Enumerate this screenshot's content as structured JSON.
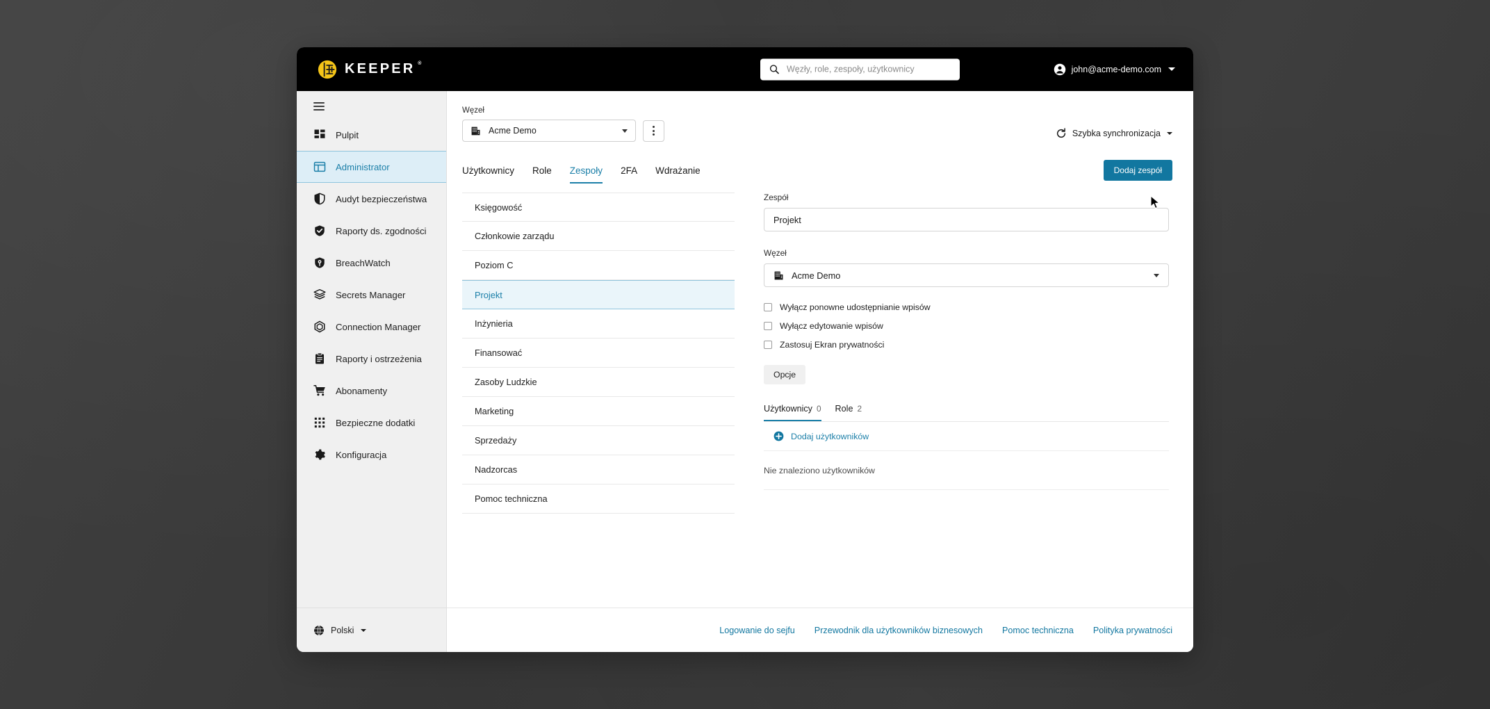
{
  "app": {
    "brand_name": "KEEPER",
    "brand_icon": "keeper-logo-icon"
  },
  "search": {
    "placeholder": "Węzły, role, zespoły, użytkownicy",
    "value": "",
    "icon": "search-icon"
  },
  "account": {
    "email": "john@acme-demo.com",
    "icon": "account-circle-icon",
    "caret": "chevron-down-icon"
  },
  "sidebar": {
    "menu_icon": "hamburger-menu-icon",
    "items": [
      {
        "label": "Pulpit",
        "icon": "dashboard-icon",
        "active": false
      },
      {
        "label": "Administrator",
        "icon": "admin-panel-icon",
        "active": true
      },
      {
        "label": "Audyt bezpieczeństwa",
        "icon": "shield-outline-icon",
        "active": false
      },
      {
        "label": "Raporty ds. zgodności",
        "icon": "shield-check-icon",
        "active": false
      },
      {
        "label": "BreachWatch",
        "icon": "breachwatch-shield-icon",
        "active": false
      },
      {
        "label": "Secrets Manager",
        "icon": "layers-icon",
        "active": false
      },
      {
        "label": "Connection Manager",
        "icon": "hexagon-node-icon",
        "active": false
      },
      {
        "label": "Raporty i ostrzeżenia",
        "icon": "clipboard-icon",
        "active": false
      },
      {
        "label": "Abonamenty",
        "icon": "shopping-cart-icon",
        "active": false
      },
      {
        "label": "Bezpieczne dodatki",
        "icon": "grid-dots-icon",
        "active": false
      },
      {
        "label": "Konfiguracja",
        "icon": "gear-icon",
        "active": false
      }
    ],
    "language": {
      "label": "Polski",
      "icon": "globe-icon",
      "caret": "chevron-down-icon"
    }
  },
  "node_bar": {
    "label": "Węzeł",
    "selected": "Acme Demo",
    "select_icon": "building-icon",
    "caret": "chevron-down-icon",
    "kebab": "more-vertical-icon"
  },
  "sync": {
    "label": "Szybka synchronizacja",
    "icon": "refresh-icon",
    "caret": "chevron-down-icon"
  },
  "tabs": [
    {
      "label": "Użytkownicy",
      "active": false
    },
    {
      "label": "Role",
      "active": false
    },
    {
      "label": "Zespoły",
      "active": true
    },
    {
      "label": "2FA",
      "active": false
    },
    {
      "label": "Wdrażanie",
      "active": false
    }
  ],
  "add_team_button": "Dodaj zespół",
  "teams": [
    {
      "name": "Księgowość",
      "selected": false
    },
    {
      "name": "Członkowie zarządu",
      "selected": false
    },
    {
      "name": "Poziom C",
      "selected": false
    },
    {
      "name": "Projekt",
      "selected": true
    },
    {
      "name": "Inżynieria",
      "selected": false
    },
    {
      "name": "Finansować",
      "selected": false
    },
    {
      "name": "Zasoby Ludzkie",
      "selected": false
    },
    {
      "name": "Marketing",
      "selected": false
    },
    {
      "name": "Sprzedaży",
      "selected": false
    },
    {
      "name": "Nadzorcas",
      "selected": false
    },
    {
      "name": "Pomoc techniczna",
      "selected": false
    }
  ],
  "detail": {
    "team_label": "Zespół",
    "team_value": "Projekt",
    "node_label": "Węzeł",
    "node_value": "Acme Demo",
    "node_icon": "building-icon",
    "node_caret": "chevron-down-icon",
    "checkboxes": [
      {
        "label": "Wyłącz ponowne udostępnianie wpisów",
        "checked": false
      },
      {
        "label": "Wyłącz edytowanie wpisów",
        "checked": false
      },
      {
        "label": "Zastosuj Ekran prywatności",
        "checked": false
      }
    ],
    "options_button": "Opcje",
    "subtabs": [
      {
        "label": "Użytkownicy",
        "count": "0",
        "active": true
      },
      {
        "label": "Role",
        "count": "2",
        "active": false
      }
    ],
    "add_users_label": "Dodaj użytkowników",
    "add_users_icon": "plus-circle-icon",
    "empty_message": "Nie znaleziono użytkowników"
  },
  "footer_links": [
    "Logowanie do sejfu",
    "Przewodnik dla użytkowników biznesowych",
    "Pomoc techniczna",
    "Polityka prywatności"
  ],
  "colors": {
    "accent_blue": "#1b7fa8",
    "button_blue": "#1277a0",
    "brand_yellow": "#f5c518",
    "topbar_black": "#000000",
    "sidebar_gray": "#f0f0f0",
    "selected_row": "#eaf5fa"
  }
}
